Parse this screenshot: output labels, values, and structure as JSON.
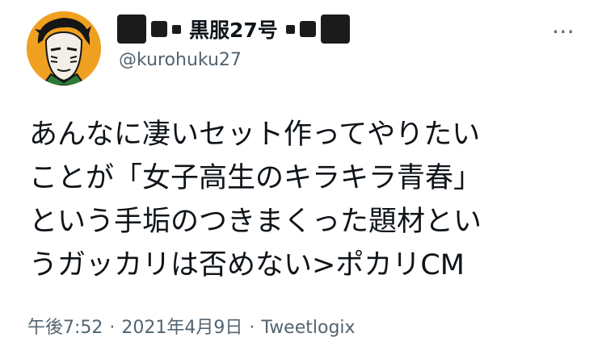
{
  "user": {
    "display_name": "黒服27号",
    "handle": "@kurohuku27"
  },
  "more_icon": "⋯",
  "tweet": {
    "lines": [
      "あんなに凄いセット作ってやりたい",
      "ことが「女子高生のキラキラ青春」",
      "という手垢のつきまくった題材とい",
      "うガッカリは否めない>ポカリCM"
    ]
  },
  "meta": {
    "time": "午後7:52",
    "date": "2021年4月9日",
    "client": "Tweetlogix",
    "separator": "·"
  },
  "colors": {
    "text": "#0f1419",
    "secondary": "#536471",
    "avatar_bg": "#f0a020"
  }
}
